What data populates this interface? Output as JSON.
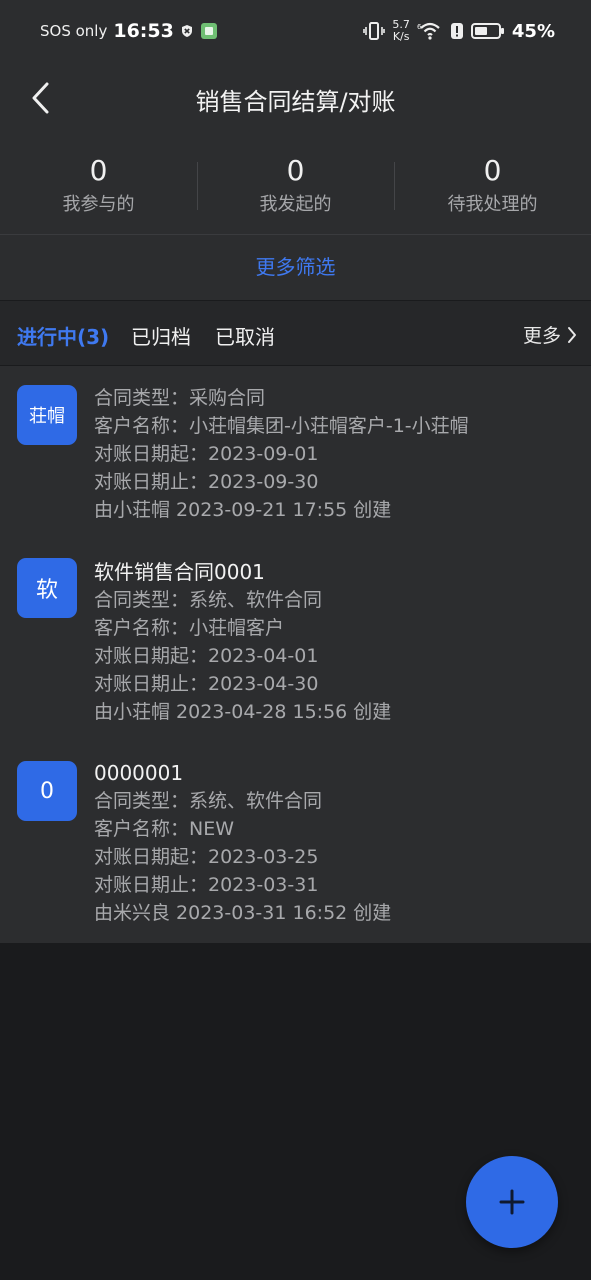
{
  "status_bar": {
    "carrier": "SOS only",
    "time": "16:53",
    "speed_value": "5.7",
    "speed_unit": "K/s",
    "battery": "45%"
  },
  "header": {
    "title": "销售合同结算/对账",
    "back_icon": "chevron-left-icon"
  },
  "stats": [
    {
      "count": "0",
      "label": "我参与的"
    },
    {
      "count": "0",
      "label": "我发起的"
    },
    {
      "count": "0",
      "label": "待我处理的"
    }
  ],
  "filter_label": "更多筛选",
  "tabs": [
    {
      "label": "进行中(3)",
      "active": true
    },
    {
      "label": "已归档",
      "active": false
    },
    {
      "label": "已取消",
      "active": false
    }
  ],
  "more_label": "更多",
  "contracts": [
    {
      "avatar": "荘帽",
      "title": "",
      "type": "合同类型：采购合同",
      "customer": "客户名称：小荘帽集团-小荘帽客户-1-小荘帽",
      "start": "对账日期起：2023-09-01",
      "end": "对账日期止：2023-09-30",
      "created": "由小荘帽 2023-09-21 17:55 创建"
    },
    {
      "avatar": "软",
      "title": "软件销售合同0001",
      "type": "合同类型：系统、软件合同",
      "customer": "客户名称：小荘帽客户",
      "start": "对账日期起：2023-04-01",
      "end": "对账日期止：2023-04-30",
      "created": "由小荘帽 2023-04-28 15:56 创建"
    },
    {
      "avatar": "0",
      "title": "0000001",
      "type": "合同类型：系统、软件合同",
      "customer": "客户名称：NEW",
      "start": "对账日期起：2023-03-25",
      "end": "对账日期止：2023-03-31",
      "created": "由米兴良 2023-03-31 16:52 创建"
    }
  ],
  "fab_icon": "plus-icon",
  "colors": {
    "accent": "#2f6ae6",
    "link": "#3f79f0"
  }
}
